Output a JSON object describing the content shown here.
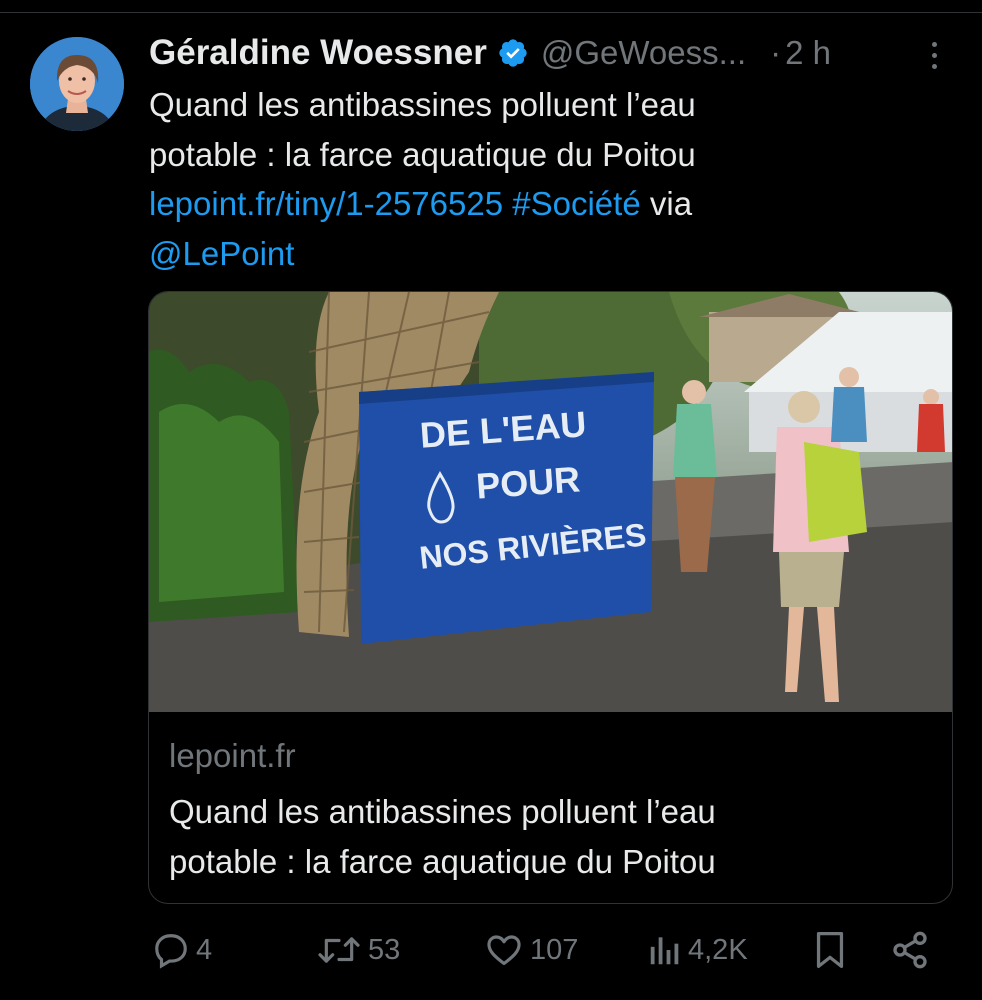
{
  "author": {
    "name": "Géraldine Woessner",
    "handle": "@GeWoess...",
    "separator": "·",
    "time": "2 h"
  },
  "tweet": {
    "line1": "Quand les antibassines polluent l’eau",
    "line2": "potable : la farce aquatique du Poitou",
    "link": "lepoint.fr/tiny/1-2576525",
    "hashtag": "#Société",
    "via": "via",
    "mention": "@LePoint"
  },
  "card": {
    "banner_line1": "DE L'EAU",
    "banner_line2": "POUR",
    "banner_line3": "NOS RIVIÈRES",
    "domain": "lepoint.fr",
    "title_line1": "Quand les antibassines polluent l’eau",
    "title_line2": "potable : la farce aquatique du Poitou"
  },
  "actions": {
    "replies": "4",
    "reposts": "53",
    "likes": "107",
    "views": "4,2K"
  },
  "icons": {
    "verified": "verified-badge-icon",
    "more": "more-dots-icon",
    "reply": "reply-icon",
    "repost": "repost-icon",
    "like": "heart-icon",
    "views": "views-bar-chart-icon",
    "bookmark": "bookmark-icon",
    "share": "share-icon"
  },
  "colors": {
    "background": "#000000",
    "text": "#e7e9ea",
    "secondary": "#71767b",
    "link": "#1d9bf0",
    "verified": "#1d9bf0",
    "banner": "#1f4fa8"
  }
}
